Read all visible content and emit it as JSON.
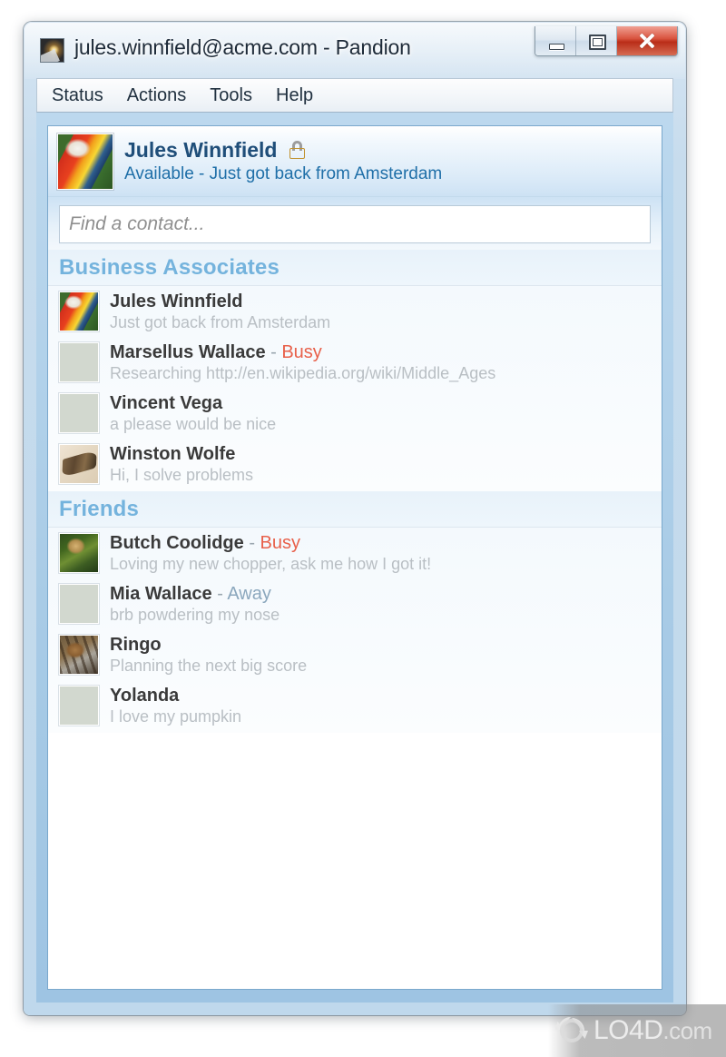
{
  "window": {
    "title": "jules.winnfield@acme.com - Pandion",
    "icon": "app-photo-icon",
    "controls": {
      "minimize": "Minimize",
      "maximize": "Maximize",
      "close": "Close"
    }
  },
  "menu": {
    "items": [
      {
        "label": "Status"
      },
      {
        "label": "Actions"
      },
      {
        "label": "Tools"
      },
      {
        "label": "Help"
      }
    ]
  },
  "profile": {
    "display_name": "Jules Winnfield",
    "lock_icon": "lock-icon",
    "status_line": "Available - Just got back from Amsterdam",
    "avatar": "parrot-photo"
  },
  "search": {
    "value": "",
    "placeholder": "Find a contact..."
  },
  "groups": [
    {
      "name": "Business Associates",
      "contacts": [
        {
          "name": "Jules Winnfield",
          "separator": "",
          "status": "",
          "status_kind": "",
          "message": "Just got back from Amsterdam",
          "avatar": "parrot-photo"
        },
        {
          "name": "Marsellus Wallace",
          "separator": " - ",
          "status": "Busy",
          "status_kind": "busy",
          "message": "Researching http://en.wikipedia.org/wiki/Middle_Ages",
          "avatar": "eagle-photo"
        },
        {
          "name": "Vincent Vega",
          "separator": "",
          "status": "",
          "status_kind": "",
          "message": "a please would be nice",
          "avatar": "flower-photo"
        },
        {
          "name": "Winston Wolfe",
          "separator": "",
          "status": "",
          "status_kind": "",
          "message": "Hi, I solve problems",
          "avatar": "wing-photo"
        }
      ]
    },
    {
      "name": "Friends",
      "contacts": [
        {
          "name": "Butch Coolidge",
          "separator": " - ",
          "status": "Busy",
          "status_kind": "busy",
          "message": "Loving my new chopper, ask me how I got it!",
          "avatar": "green-animal-photo"
        },
        {
          "name": "Mia Wallace",
          "separator": " - ",
          "status": "Away",
          "status_kind": "away",
          "message": "brb powdering my nose",
          "avatar": "fox-photo"
        },
        {
          "name": "Ringo",
          "separator": "",
          "status": "",
          "status_kind": "",
          "message": "Planning the next big score",
          "avatar": "cat-photo"
        },
        {
          "name": "Yolanda",
          "separator": "",
          "status": "",
          "status_kind": "",
          "message": "I love my pumpkin",
          "avatar": "chick-photo"
        }
      ]
    }
  ],
  "watermark": {
    "text": "LO4D",
    "suffix": ".com",
    "logo": "refresh-arrows-logo"
  },
  "colors": {
    "accent_blue": "#1f4e79",
    "status_link_blue": "#1f6fa8",
    "group_header_blue": "#74b3dd",
    "busy_red": "#e8604a",
    "away_gray_blue": "#8ba7bd",
    "message_gray": "#b9bfc4",
    "close_button_red": "#c4371f"
  }
}
